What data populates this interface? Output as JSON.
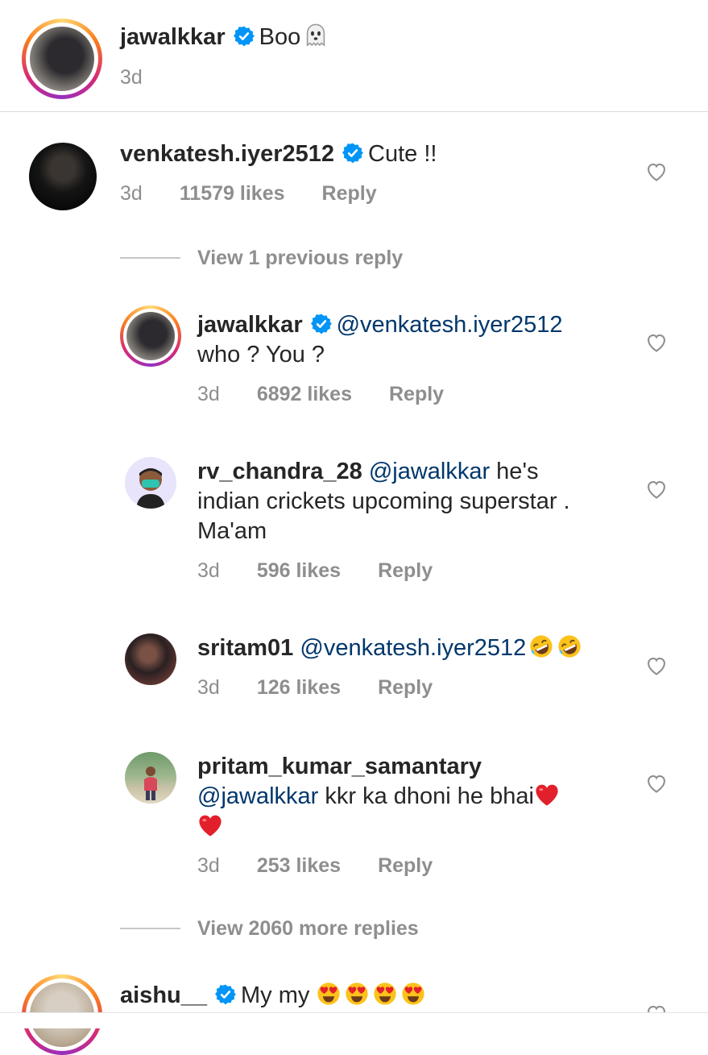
{
  "caption": {
    "username": "jawalkkar",
    "text": "Boo",
    "emoji": "ghost-emoji",
    "time": "3d"
  },
  "comment1": {
    "username": "venkatesh.iyer2512",
    "text": "Cute !!",
    "time": "3d",
    "likes": "11579 likes",
    "reply": "Reply"
  },
  "view_previous": "View 1 previous reply",
  "replies": [
    {
      "username": "jawalkkar",
      "mention": "@venkatesh.iyer2512",
      "text": "who ? You ?",
      "time": "3d",
      "likes": "6892 likes",
      "reply": "Reply"
    },
    {
      "username": "rv_chandra_28",
      "mention": "@jawalkkar",
      "text_line1": " he's",
      "text_line2": "indian crickets upcoming superstar .",
      "text_line3": "Ma'am",
      "time": "3d",
      "likes": "596 likes",
      "reply": "Reply"
    },
    {
      "username": "sritam01",
      "mention": "@venkatesh.iyer2512",
      "emoji": "rofl-emoji",
      "time": "3d",
      "likes": "126 likes",
      "reply": "Reply"
    },
    {
      "username": "pritam_kumar_samantary",
      "mention": "@jawalkkar",
      "text": " kkr ka dhoni he bhai",
      "emoji": "red-heart-emoji",
      "time": "3d",
      "likes": "253 likes",
      "reply": "Reply"
    }
  ],
  "view_more": "View 2060 more replies",
  "comment2": {
    "username": "aishu__",
    "text": "My my",
    "emoji": "heart-eyes-emoji"
  },
  "colors": {
    "text": "#262626",
    "secondary": "#8e8e8e",
    "mention": "#00376b",
    "verified": "#0095f6",
    "separator": "#dbdbdb"
  }
}
